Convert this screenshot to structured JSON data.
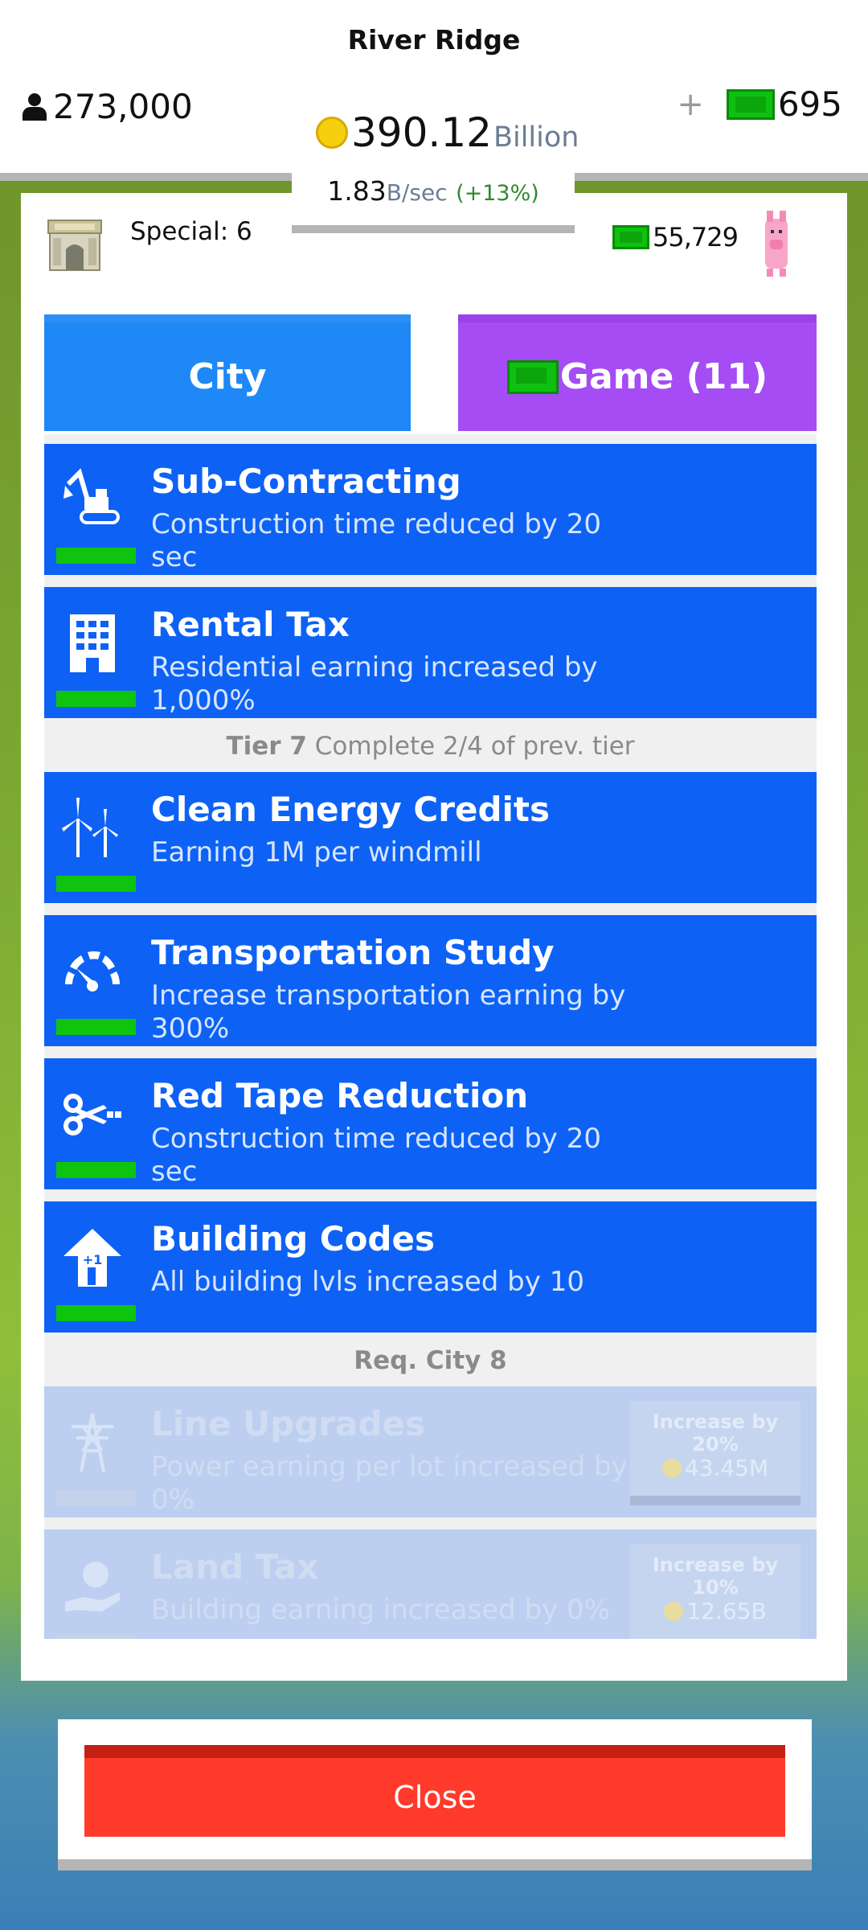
{
  "header": {
    "city_name": "River Ridge",
    "population": "273,000",
    "plus": "+",
    "cash": "695",
    "coins": "390.12",
    "coins_unit": "Billion",
    "rate_value": "1.83",
    "rate_unit": "B",
    "rate_suffix": "/sec",
    "rate_change": "(+13%)"
  },
  "special": {
    "label": "Special: 6"
  },
  "piggy": {
    "cash": "55,729"
  },
  "tabs": {
    "city": "City",
    "game": "Game (11)"
  },
  "items_tier6": [
    {
      "title": "Sub-Contracting",
      "desc": "Construction time reduced by 20 sec",
      "icon": "excavator-icon"
    },
    {
      "title": "Rental Tax",
      "desc": "Residential earning increased by 1,000%",
      "icon": "building-icon"
    }
  ],
  "tier7": {
    "label": "Tier 7",
    "requirement": "Complete 2/4 of prev. tier"
  },
  "items_tier7": [
    {
      "title": "Clean Energy Credits",
      "desc": "Earning 1M per windmill",
      "icon": "windmill-icon"
    },
    {
      "title": "Transportation Study",
      "desc": "Increase transportation earning by 300%",
      "icon": "speedometer-icon"
    },
    {
      "title": "Red Tape Reduction",
      "desc": "Construction time reduced by 20 sec",
      "icon": "scissors-icon"
    },
    {
      "title": "Building Codes",
      "desc": "All building lvls increased by 10",
      "icon": "level-up-icon"
    }
  ],
  "tier8": {
    "requirement": "Req. City 8"
  },
  "items_tier8": [
    {
      "title": "Line Upgrades",
      "desc": "Power earning per lot increased by 0%",
      "upgrade": "Increase by 20%",
      "cost": "43.45M",
      "icon": "power-tower-icon"
    },
    {
      "title": "Land Tax",
      "desc": "Building earning increased by 0%",
      "upgrade": "Increase by 10%",
      "cost": "12.65B",
      "icon": "money-hand-icon"
    }
  ],
  "close_label": "Close"
}
